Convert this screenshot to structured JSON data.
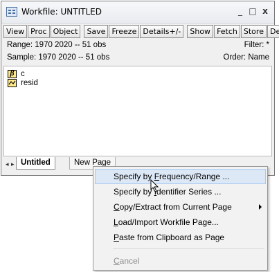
{
  "window": {
    "title": "Workfile: UNTITLED",
    "controls": {
      "minimize": "_",
      "maximize": "□",
      "close": "x"
    }
  },
  "toolbar": {
    "buttons": [
      "View",
      "Proc",
      "Object",
      "Save",
      "Freeze",
      "Details+/-",
      "Show",
      "Fetch",
      "Store",
      "Del"
    ]
  },
  "info": {
    "range": "Range:  1970 2020  --  51 obs",
    "filter": "Filter: *",
    "sample": "Sample: 1970 2020  --  51 obs",
    "order": "Order: Name"
  },
  "objects": [
    {
      "name": "c",
      "icon": "coefficient-icon",
      "glyph": "β"
    },
    {
      "name": "resid",
      "icon": "series-icon"
    }
  ],
  "tabs": {
    "active": "Untitled",
    "inactive": "New Page"
  },
  "context_menu": {
    "items": [
      {
        "before": "Specify by ",
        "mnemonic": "F",
        "after": "requency/Range ...",
        "highlighted": true
      },
      {
        "before": "Specify by ",
        "mnemonic": "I",
        "after": "dentifier Series ...",
        "highlighted": false
      },
      {
        "before": "",
        "mnemonic": "C",
        "after": "opy/Extract from Current Page",
        "submenu": true
      },
      {
        "before": "",
        "mnemonic": "L",
        "after": "oad/Import Workfile Page...",
        "submenu": false
      },
      {
        "before": "",
        "mnemonic": "P",
        "after": "aste from Clipboard as Page",
        "submenu": false
      },
      {
        "before": "",
        "mnemonic": "C",
        "after": "ancel",
        "disabled": true
      }
    ]
  }
}
